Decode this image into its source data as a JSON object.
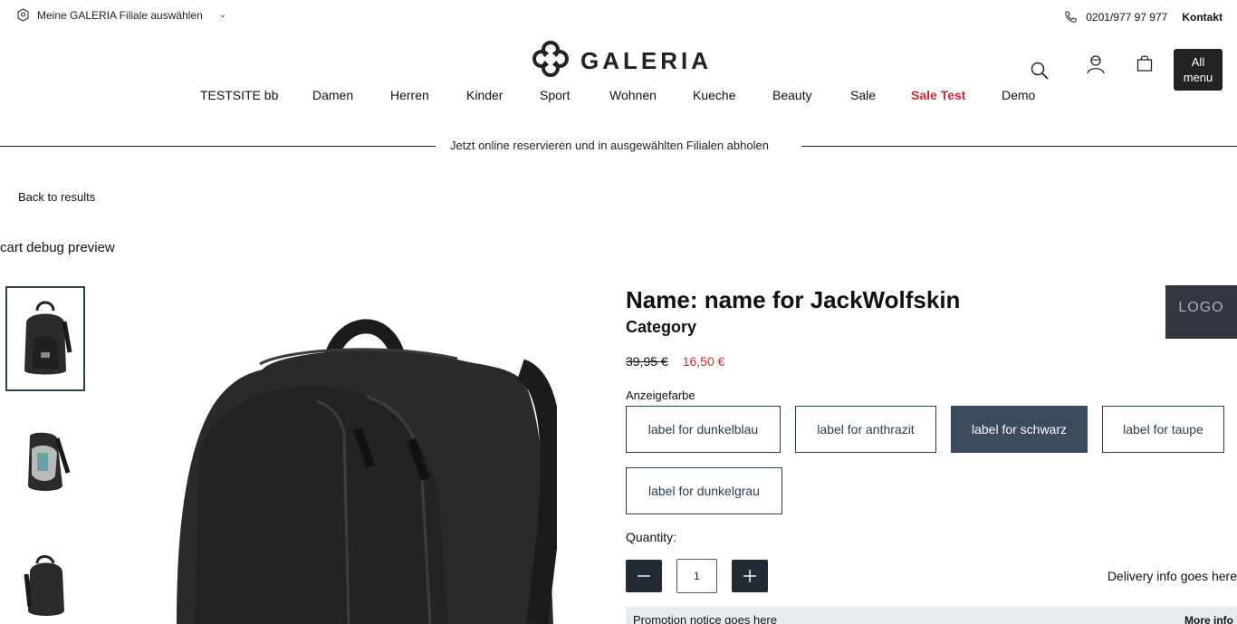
{
  "topbar": {
    "store_label": "Meine GALERIA Filiale auswählen",
    "store_icon": "store-pin-icon",
    "phone": "0201/977 97 977",
    "contact_label": "Kontakt"
  },
  "logo": {
    "wordmark": "GALERIA"
  },
  "header_icons": [
    "search-icon",
    "account-icon",
    "cart-icon"
  ],
  "all_menu": {
    "line1": "All",
    "line2": "menu"
  },
  "nav": {
    "items": [
      "TESTSITE bb",
      "Damen",
      "Herren",
      "Kinder",
      "Sport",
      "Wohnen",
      "Kueche",
      "Beauty",
      "Sale",
      "Sale Test",
      "Demo"
    ],
    "highlight_color": "#d7262d"
  },
  "promo_banner": "Jetzt online reservieren und in ausgewählten Filialen abholen",
  "back_label": "Back to results",
  "debug_label": "cart debug preview",
  "product": {
    "name": "Name: name for JackWolfskin",
    "category": "Category",
    "brand_logo": "LOGO",
    "old_price": "39,95 €",
    "new_price": "16,50 €",
    "color_label": "Anzeigefarbe",
    "colors": [
      {
        "label": "label for dunkelblau",
        "selected": false
      },
      {
        "label": "label for anthrazit",
        "selected": false
      },
      {
        "label": "label for schwarz",
        "selected": true
      },
      {
        "label": "label for taupe",
        "selected": false
      },
      {
        "label": "label for dunkelgrau",
        "selected": false
      }
    ],
    "quantity_label": "Quantity:",
    "quantity_value": "1",
    "delivery": "Delivery info goes here",
    "promotion": "Promotion notice goes here",
    "more_info": "More info"
  },
  "colors": {
    "accent": "#d7262d",
    "selected_swatch": "#3b4a5c",
    "dark": "#222a33"
  }
}
